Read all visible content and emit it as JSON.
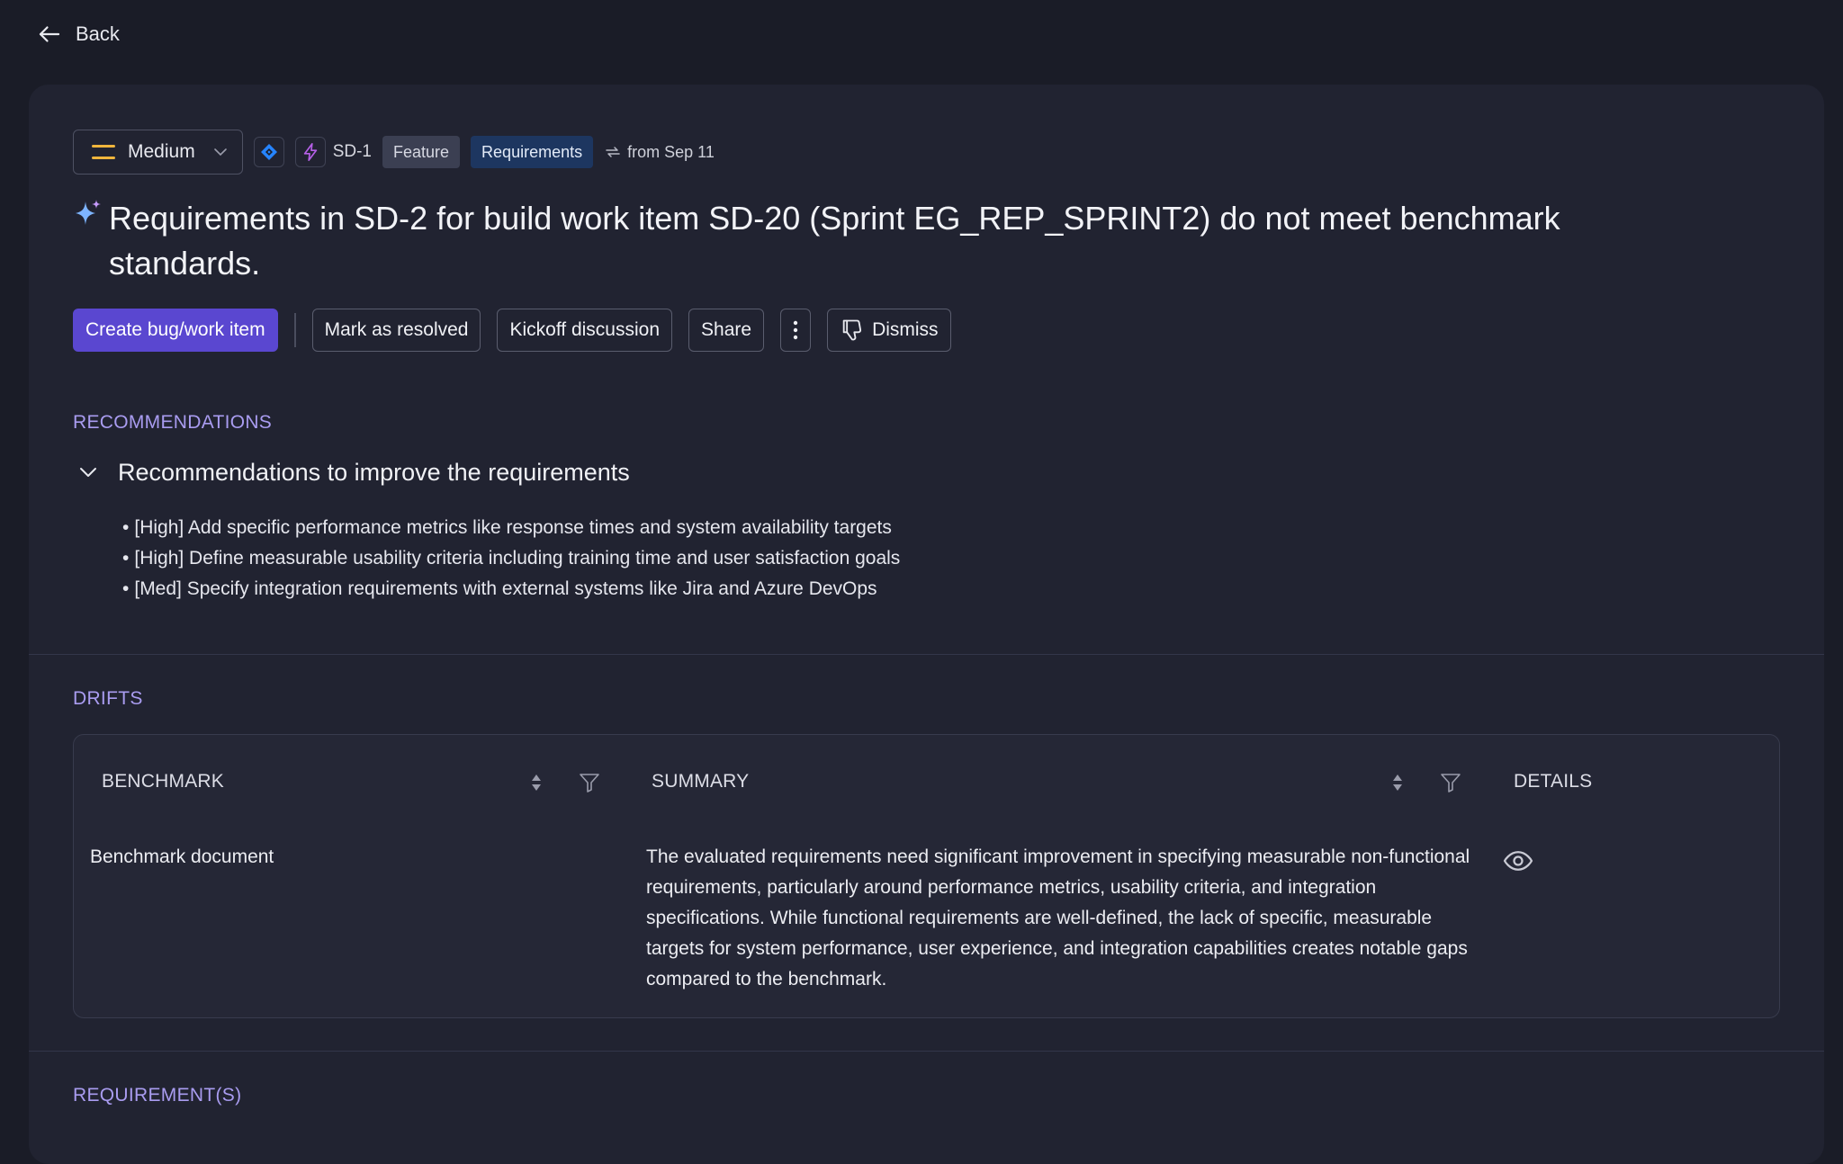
{
  "nav": {
    "back_label": "Back"
  },
  "meta": {
    "priority": "Medium",
    "item_id": "SD-1",
    "tags": [
      "Feature",
      "Requirements"
    ],
    "from_text": "from Sep 11"
  },
  "title": "Requirements in SD-2 for build work item SD-20 (Sprint EG_REP_SPRINT2) do not meet benchmark standards.",
  "actions": {
    "create": "Create bug/work item",
    "resolve": "Mark as resolved",
    "kickoff": "Kickoff discussion",
    "share": "Share",
    "dismiss": "Dismiss"
  },
  "recommendations": {
    "section_label": "RECOMMENDATIONS",
    "heading": "Recommendations to improve the requirements",
    "items": [
      "[High] Add specific performance metrics like response times and system availability targets",
      "[High] Define measurable usability criteria including training time and user satisfaction goals",
      "[Med] Specify integration requirements with external systems like Jira and Azure DevOps"
    ]
  },
  "drifts": {
    "section_label": "DRIFTS",
    "columns": [
      "BENCHMARK",
      "SUMMARY",
      "DETAILS"
    ],
    "rows": [
      {
        "benchmark": "Benchmark document",
        "summary": "The evaluated requirements need significant improvement in specifying measurable non-functional requirements, particularly around performance metrics, usability criteria, and integration specifications. While functional requirements are well-defined, the lack of specific, measurable targets for system performance, user experience, and integration capabilities creates notable gaps compared to the benchmark."
      }
    ]
  },
  "requirements": {
    "section_label": "REQUIREMENT(S)"
  },
  "colors": {
    "accent": "#5a47d0",
    "section_label": "#a99cf0",
    "priority_medium": "#f0b53c",
    "jira_blue": "#2684ff",
    "epic_purple": "#b660e8"
  },
  "icons": {
    "back": "arrow-left-icon",
    "priority": "priority-medium-icon",
    "source": "jira-icon",
    "item_type": "lightning-icon",
    "sync": "sync-icon",
    "title": "sparkle-icon",
    "more": "kebab-icon",
    "dismiss": "thumbs-down-icon",
    "collapse": "chevron-down-icon",
    "sort": "sort-icon",
    "filter": "filter-icon",
    "details": "eye-icon"
  }
}
